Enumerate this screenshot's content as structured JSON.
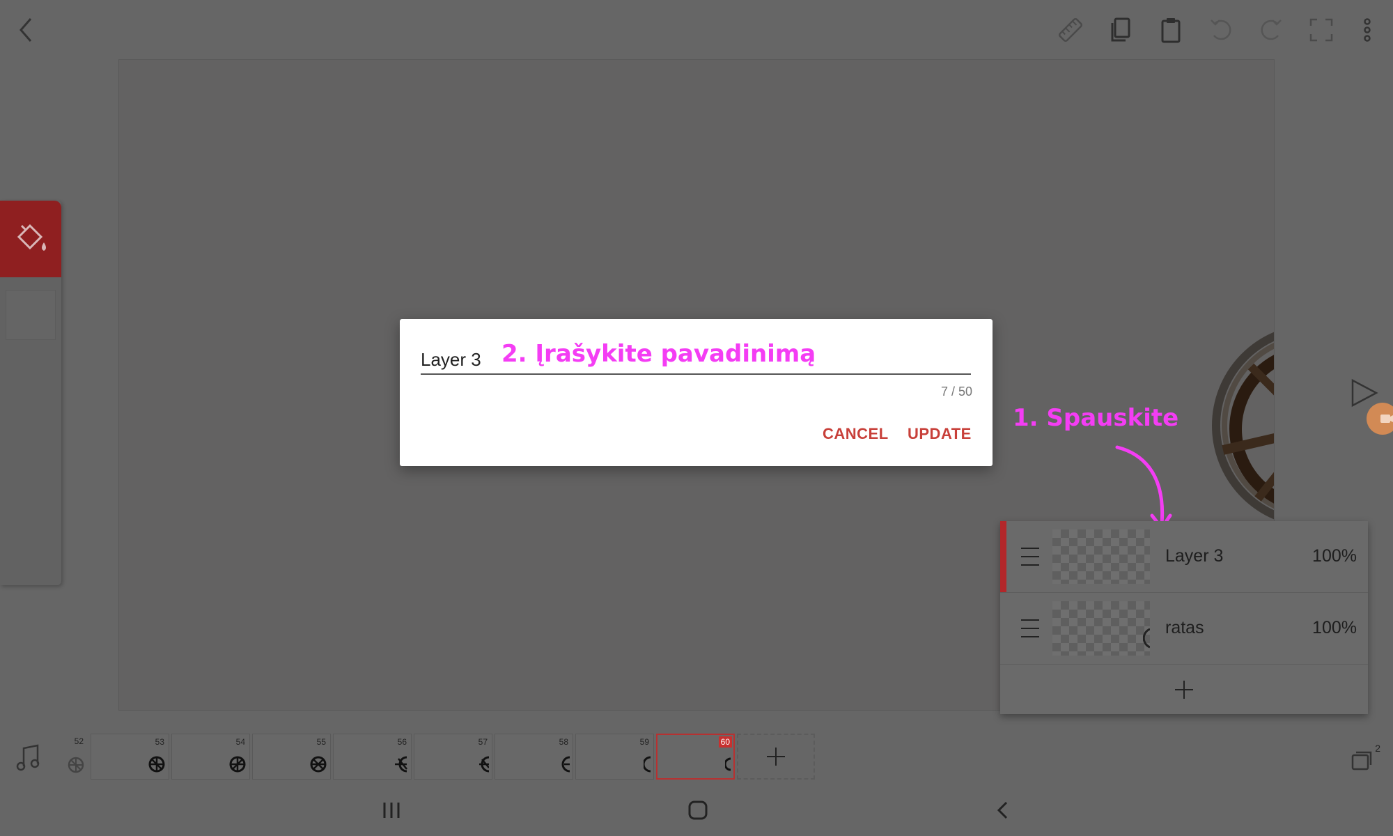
{
  "toolbar": {
    "icons": [
      "back-icon",
      "ruler-icon",
      "copy-icon",
      "paste-icon",
      "undo-icon",
      "redo-icon",
      "fullscreen-icon",
      "more-icon"
    ]
  },
  "dialog": {
    "input_value": "Layer 3",
    "char_count": "7 / 50",
    "cancel_label": "CANCEL",
    "update_label": "UPDATE"
  },
  "annotations": {
    "step1": "1. Spauskite",
    "step2": "2. Įrašykite pavadinimą",
    "color": "#f43df4"
  },
  "layers": [
    {
      "name": "Layer 3",
      "opacity": "100%",
      "selected": true
    },
    {
      "name": "ratas",
      "opacity": "100%",
      "selected": false
    }
  ],
  "timeline": {
    "frames": [
      "52",
      "53",
      "54",
      "55",
      "56",
      "57",
      "58",
      "59",
      "60"
    ],
    "current_frame": "60"
  },
  "layers_button": {
    "count": "2"
  },
  "colors": {
    "accent": "#c8403a",
    "selected_layer": "#b3272a",
    "paint_tool_bg": "#8f1f20",
    "overlay_bg": "#666666"
  }
}
